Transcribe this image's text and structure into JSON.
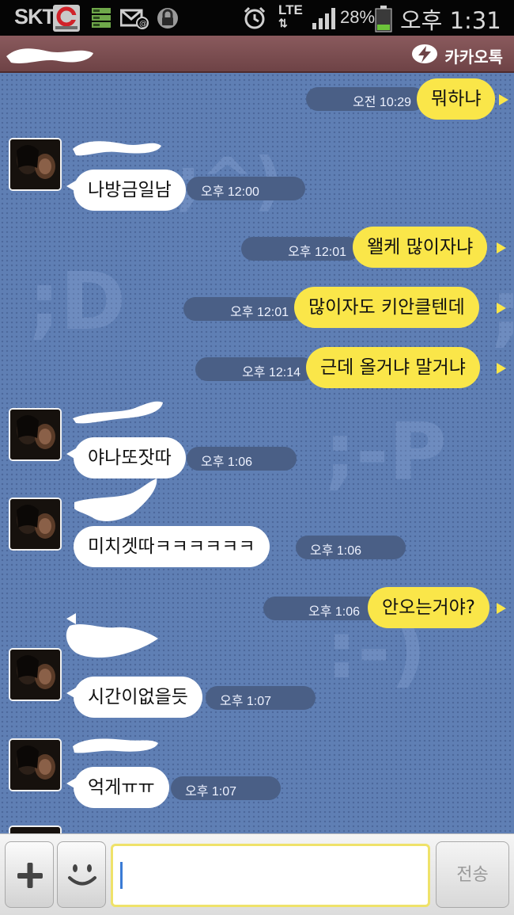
{
  "status_bar": {
    "carrier": "SKT",
    "network": "LTE",
    "battery_percent": "28%",
    "time": "오후 1:31",
    "icons": [
      "clean-master-icon",
      "storage-icon",
      "mail-notification-icon",
      "lock-icon",
      "alarm-icon",
      "lte-icon",
      "signal-icon",
      "battery-icon"
    ]
  },
  "header": {
    "brand_label": "카카오톡",
    "brand_icon": "kakaotalk-bolt-icon",
    "colors": {
      "bar": "#7a4d50"
    }
  },
  "chat": {
    "colors": {
      "background": "#5f7fb4",
      "my_bubble": "#fae649",
      "other_bubble": "#ffffff",
      "time_pill": "#4a5f86"
    },
    "messages": [
      {
        "sender": "me",
        "text": "뭐하냐",
        "time": "오전 10:29"
      },
      {
        "sender": "other",
        "text": "나방금일남",
        "time": "오후 12:00"
      },
      {
        "sender": "me",
        "text": "왤케 많이자냐",
        "time": "오후 12:01"
      },
      {
        "sender": "me",
        "text": "많이자도 키안클텐데",
        "time": "오후 12:01"
      },
      {
        "sender": "me",
        "text": "근데 올거냐 말거냐",
        "time": "오후 12:14"
      },
      {
        "sender": "other",
        "text": "야나또잣따",
        "time": "오후 1:06"
      },
      {
        "sender": "other",
        "text": "미치겟따ㅋㅋㅋㅋㅋㅋ",
        "time": "오후 1:06"
      },
      {
        "sender": "me",
        "text": "안오는거야?",
        "time": "오후 1:06"
      },
      {
        "sender": "other",
        "text": "시간이없을듯",
        "time": "오후 1:07"
      },
      {
        "sender": "other",
        "text": "억게ㅠㅠ",
        "time": "오후 1:07"
      }
    ]
  },
  "input_bar": {
    "send_label": "전송",
    "input_value": "",
    "plus_icon": "plus-icon",
    "emoticon_icon": "smiley-icon"
  }
}
